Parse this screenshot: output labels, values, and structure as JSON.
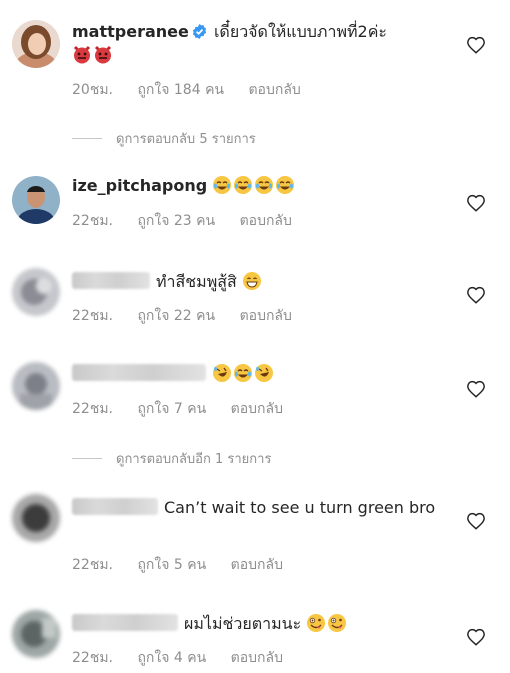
{
  "comments": [
    {
      "username": "mattperanee",
      "verified": true,
      "text": "เดี๋ยวจัดให้แบบภาพที่2ค่ะ",
      "emojis": [
        "devil",
        "devil"
      ],
      "time": "20ชม.",
      "likes": "ถูกใจ 184 คน",
      "reply": "ตอบกลับ",
      "view_replies": "ดูการตอบกลับ 5 รายการ"
    },
    {
      "username": "ize_pitchapong",
      "verified": false,
      "text": "",
      "emojis": [
        "joy",
        "joy",
        "joy",
        "joy"
      ],
      "time": "22ชม.",
      "likes": "ถูกใจ 23 คน",
      "reply": "ตอบกลับ"
    },
    {
      "username": "",
      "text": "ทำสีชมพูสู้สิ",
      "emojis": [
        "grin"
      ],
      "time": "22ชม.",
      "likes": "ถูกใจ 22 คน",
      "reply": "ตอบกลับ"
    },
    {
      "username": "",
      "text": "",
      "emojis": [
        "rofl",
        "joy",
        "rofl"
      ],
      "time": "22ชม.",
      "likes": "ถูกใจ 7 คน",
      "reply": "ตอบกลับ",
      "view_replies": "ดูการตอบกลับอีก 1 รายการ"
    },
    {
      "username": "",
      "text": "Can’t wait to see u turn green bro",
      "emojis": [],
      "time": "22ชม.",
      "likes": "ถูกใจ 5 คน",
      "reply": "ตอบกลับ"
    },
    {
      "username": "",
      "text": "ผมไม่ช่วยตามนะ",
      "emojis": [
        "zany",
        "zany"
      ],
      "time": "22ชม.",
      "likes": "ถูกใจ 4 คน",
      "reply": "ตอบกลับ"
    }
  ],
  "icons": {
    "like": "heart-icon",
    "verified": "verified-badge-icon"
  },
  "colors": {
    "verified": "#3897f0",
    "muted": "#8e8e8e",
    "text": "#262626"
  }
}
